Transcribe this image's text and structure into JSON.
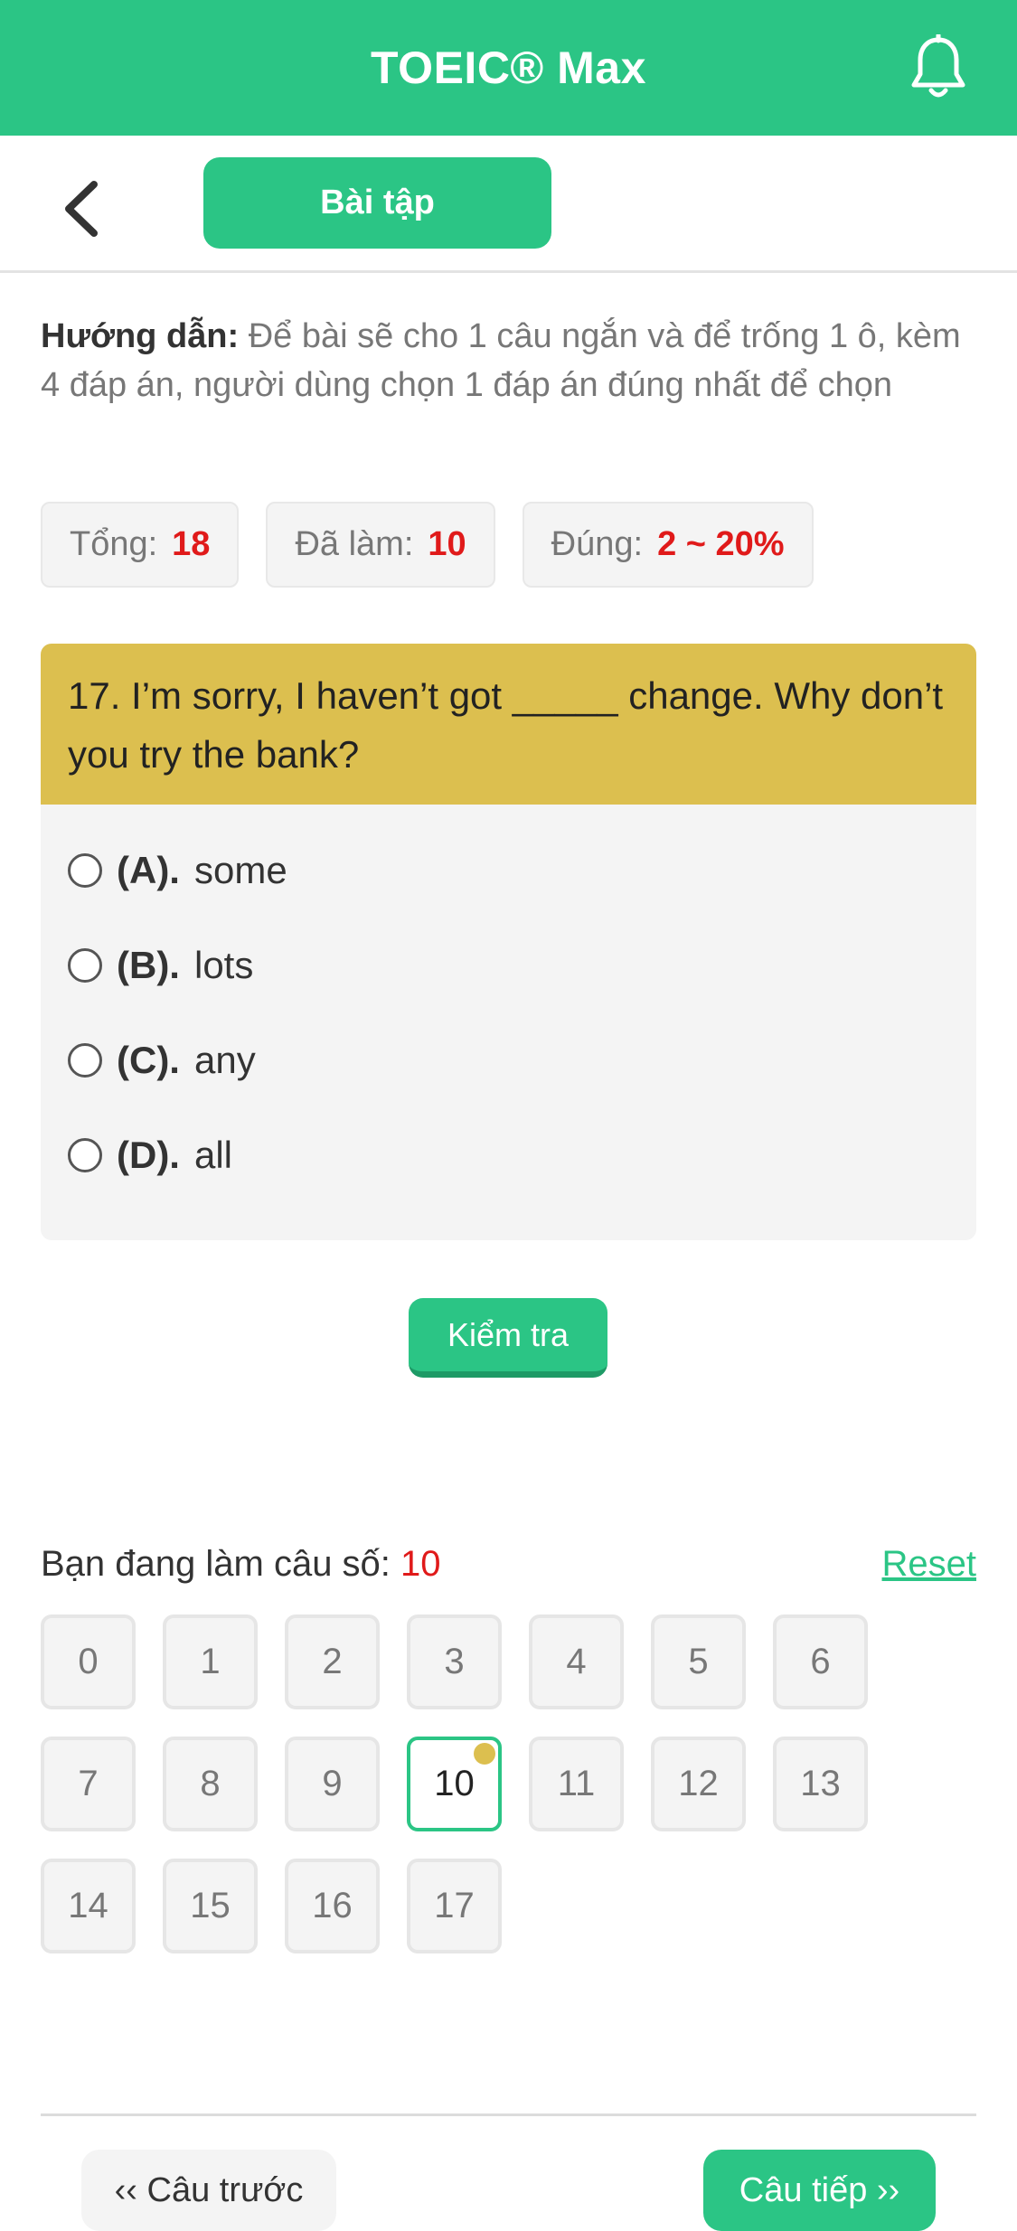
{
  "header": {
    "title": "TOEIC® Max"
  },
  "subbar": {
    "tab_label": "Bài tập"
  },
  "instruction": {
    "label": "Hướng dẫn:",
    "text": " Để bài sẽ cho 1 câu ngắn và để trống 1 ô, kèm 4 đáp án, người dùng chọn 1 đáp án đúng nhất để chọn"
  },
  "stats": {
    "total_label": "Tổng:",
    "total_value": "18",
    "done_label": "Đã làm:",
    "done_value": "10",
    "correct_label": "Đúng:",
    "correct_value": "2 ~ 20%"
  },
  "question": {
    "text": "17. I’m sorry, I haven’t got _____ change. Why don’t you try the bank?",
    "options": [
      {
        "key": "(A).",
        "text": "some"
      },
      {
        "key": "(B).",
        "text": "lots"
      },
      {
        "key": "(C).",
        "text": "any"
      },
      {
        "key": "(D).",
        "text": "all"
      }
    ]
  },
  "check_button": "Kiểm tra",
  "progress": {
    "label": "Bạn đang làm câu số: ",
    "current": "10",
    "reset_label": "Reset"
  },
  "grid": [
    "0",
    "1",
    "2",
    "3",
    "4",
    "5",
    "6",
    "7",
    "8",
    "9",
    "10",
    "11",
    "12",
    "13",
    "14",
    "15",
    "16",
    "17"
  ],
  "nav": {
    "prev_label": "‹‹ Câu trước",
    "next_label": "Câu tiếp ››"
  },
  "colors": {
    "primary": "#2bc585",
    "question_bg": "#dcbf4f",
    "highlight": "#e01a1a"
  },
  "icons": {
    "bell": "bell-icon",
    "back": "chevron-left-icon"
  }
}
